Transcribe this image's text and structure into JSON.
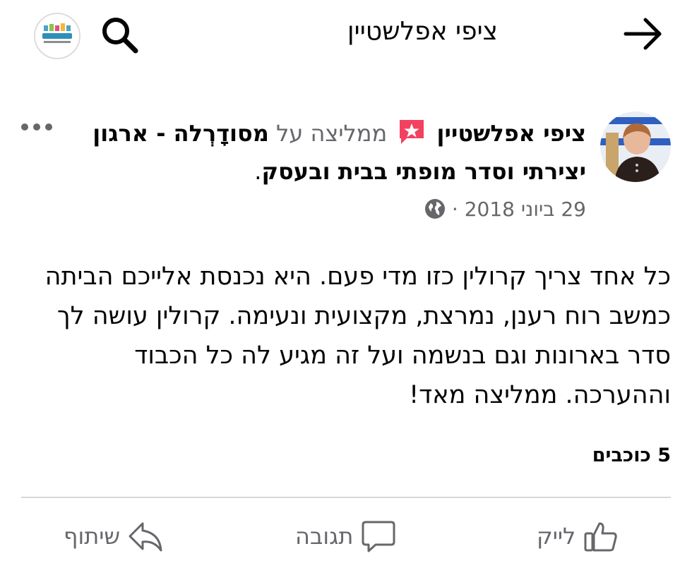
{
  "topbar": {
    "title": "ציפי אפלשטיין"
  },
  "post": {
    "author": "ציפי אפלשטיין",
    "recommends_text": "ממליצה על",
    "page_name": "מסודָרְלה - ארגון יצירתי וסדר מופתי בבית ובעסק",
    "trailing_dot": ".",
    "date": "29 ביוני 2018",
    "meta_separator": "·",
    "body": "כל אחד צריך קרולין כזו מדי פעם. היא נכנסת אלייכם הביתה כמשב רוח רענן, נמרצת, מקצועית ונעימה. קרולין עושה לך סדר בארונות וגם בנשמה ועל זה מגיע לה כל הכבוד וההערכה. ממליצה מאד!",
    "rating_text": "5 כוכבים"
  },
  "actions": {
    "like": "לייק",
    "comment": "תגובה",
    "share": "שיתוף"
  },
  "colors": {
    "text": "#050505",
    "muted": "#65676b",
    "recommend_badge": "#f3425f",
    "divider": "#d8d8d8"
  },
  "icons": [
    "back-arrow-icon",
    "search-icon",
    "page-logo",
    "recommend-icon",
    "more-icon",
    "globe-icon",
    "like-icon",
    "comment-icon",
    "share-icon"
  ]
}
